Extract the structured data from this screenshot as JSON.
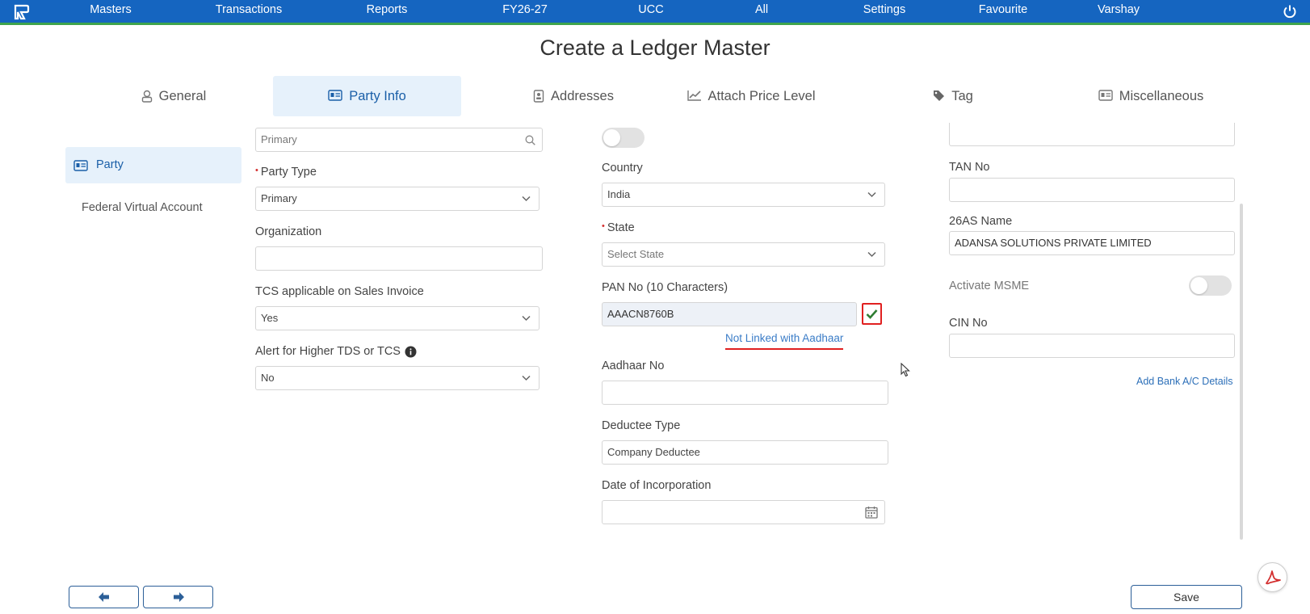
{
  "nav": {
    "items": [
      {
        "label": "Masters"
      },
      {
        "label": "Transactions"
      },
      {
        "label": "Reports"
      },
      {
        "label": "FY26-27"
      },
      {
        "label": "UCC"
      },
      {
        "label": "All"
      },
      {
        "label": "Settings"
      },
      {
        "label": "Favourite"
      },
      {
        "label": "Varshay"
      }
    ]
  },
  "page": {
    "title": "Create a Ledger Master"
  },
  "tabs": [
    {
      "label": "General",
      "icon": "user-icon"
    },
    {
      "label": "Party Info",
      "icon": "id-card-icon",
      "active": true
    },
    {
      "label": "Addresses",
      "icon": "address-book-icon"
    },
    {
      "label": "Attach Price Level",
      "icon": "line-chart-icon"
    },
    {
      "label": "Tag",
      "icon": "tag-icon"
    },
    {
      "label": "Miscellaneous",
      "icon": "id-card-icon"
    }
  ],
  "sidebar": {
    "items": [
      {
        "label": "Party",
        "active": true
      },
      {
        "label": "Federal Virtual Account"
      }
    ]
  },
  "form": {
    "col1": {
      "search_value": "Primary",
      "party_type_label": "Party Type",
      "party_type_value": "Primary",
      "organization_label": "Organization",
      "organization_value": "",
      "tcs_label": "TCS applicable on Sales Invoice",
      "tcs_value": "Yes",
      "alert_label": "Alert for Higher TDS or TCS",
      "alert_value": "No"
    },
    "col2": {
      "country_label": "Country",
      "country_value": "India",
      "state_label": "State",
      "state_placeholder": "Select State",
      "pan_label": "PAN No (10 Characters)",
      "pan_value": "AAACN8760B",
      "aadhaar_status": "Not Linked with Aadhaar",
      "aadhaar_label": "Aadhaar No",
      "aadhaar_value": "",
      "deductee_label": "Deductee Type",
      "deductee_value": "Company Deductee",
      "doi_label": "Date of Incorporation",
      "doi_value": ""
    },
    "col3": {
      "tan_label": "TAN No",
      "tan_value": "",
      "name26as_label": "26AS Name",
      "name26as_value": "ADANSA SOLUTIONS PRIVATE LIMITED",
      "msme_label": "Activate MSME",
      "cin_label": "CIN No",
      "cin_value": "",
      "add_bank_label": "Add Bank A/C Details"
    }
  },
  "footer": {
    "save_label": "Save"
  },
  "colors": {
    "brand": "#1565c0",
    "accent": "#3fa34d",
    "active_tab_bg": "#e6f1fb",
    "link": "#3a7cc7",
    "required": "#d32f2f",
    "highlight": "#e02020"
  }
}
